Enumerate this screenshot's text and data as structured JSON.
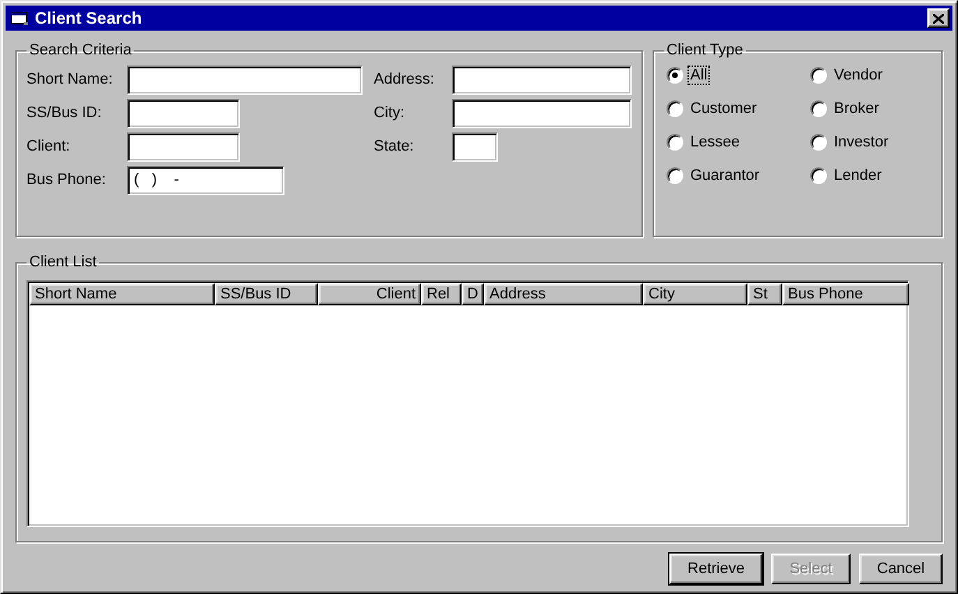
{
  "window": {
    "title": "Client Search"
  },
  "search_criteria": {
    "title": "Search Criteria",
    "left": [
      {
        "label": "Short Name:"
      },
      {
        "label": "SS/Bus ID:"
      },
      {
        "label": "Client:"
      },
      {
        "label": "Bus Phone:",
        "value": "(   )    -"
      }
    ],
    "right": [
      {
        "label": "Address:"
      },
      {
        "label": "City:"
      },
      {
        "label": "State:"
      }
    ]
  },
  "client_type": {
    "title": "Client Type",
    "options": [
      {
        "label": "All",
        "selected": true,
        "focused": true
      },
      {
        "label": "Vendor",
        "selected": false,
        "focused": false
      },
      {
        "label": "Customer",
        "selected": false,
        "focused": false
      },
      {
        "label": "Broker",
        "selected": false,
        "focused": false
      },
      {
        "label": "Lessee",
        "selected": false,
        "focused": false
      },
      {
        "label": "Investor",
        "selected": false,
        "focused": false
      },
      {
        "label": "Guarantor",
        "selected": false,
        "focused": false
      },
      {
        "label": "Lender",
        "selected": false,
        "focused": false
      }
    ]
  },
  "client_list": {
    "title": "Client List",
    "columns": [
      "Short Name",
      "SS/Bus ID",
      "Client",
      "Rel",
      "D",
      "Address",
      "City",
      "St",
      "Bus Phone"
    ]
  },
  "buttons": [
    {
      "label": "Retrieve",
      "disabled": false
    },
    {
      "label": "Select",
      "disabled": true
    },
    {
      "label": "Cancel",
      "disabled": false
    }
  ]
}
